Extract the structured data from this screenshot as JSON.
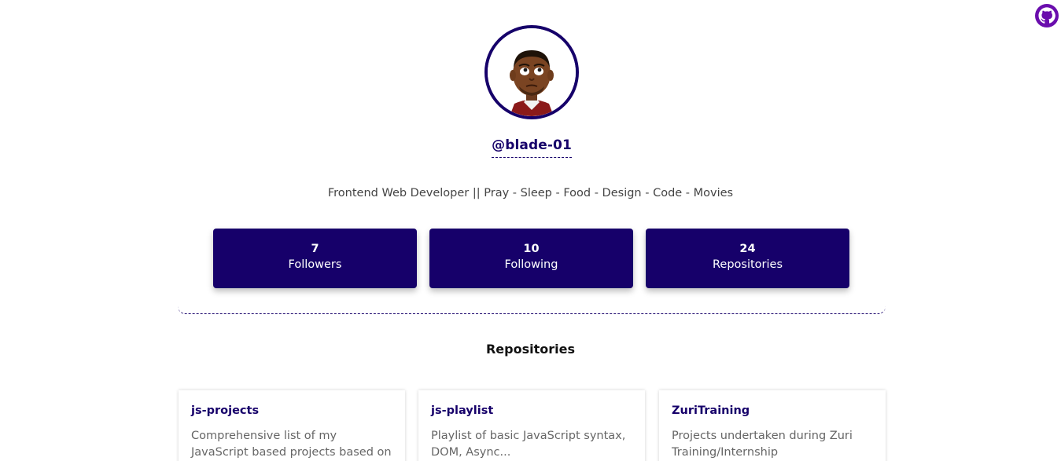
{
  "header": {
    "github_icon": "github-icon",
    "accent_color": "#16006a"
  },
  "profile": {
    "username": "@blade-01",
    "bio": "Frontend Web Developer || Pray - Sleep - Food - Design - Code - Movies"
  },
  "stats": [
    {
      "value": "7",
      "label": "Followers"
    },
    {
      "value": "10",
      "label": "Following"
    },
    {
      "value": "24",
      "label": "Repositories"
    }
  ],
  "repositories": {
    "heading": "Repositories",
    "items": [
      {
        "name": "js-projects",
        "description": "Comprehensive list of my JavaScript based projects based on"
      },
      {
        "name": "js-playlist",
        "description": "Playlist of basic JavaScript syntax, DOM, Async..."
      },
      {
        "name": "ZuriTraining",
        "description": "Projects undertaken during Zuri Training/Internship"
      }
    ]
  }
}
